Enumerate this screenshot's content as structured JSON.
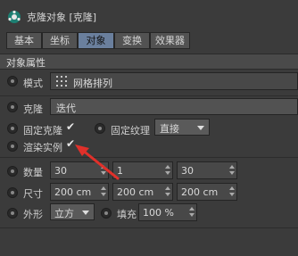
{
  "window": {
    "title": "克隆对象 [克隆]"
  },
  "tabs": [
    {
      "label": "基本",
      "active": false
    },
    {
      "label": "坐标",
      "active": false
    },
    {
      "label": "对象",
      "active": true
    },
    {
      "label": "变换",
      "active": false
    },
    {
      "label": "效果器",
      "active": false
    }
  ],
  "section": {
    "title": "对象属性"
  },
  "mode": {
    "label": "模式",
    "value": "网格排列"
  },
  "clone": {
    "label": "克隆",
    "value": "迭代"
  },
  "fix_clone": {
    "label": "固定克隆",
    "checked": "✔"
  },
  "fix_texture": {
    "label": "固定纹理",
    "value": "直接"
  },
  "render_instances": {
    "label": "渲染实例",
    "checked": "✔"
  },
  "count": {
    "label": "数量",
    "values": [
      "30",
      "1",
      "30"
    ]
  },
  "size": {
    "label": "尺寸",
    "values": [
      "200 cm",
      "200 cm",
      "200 cm"
    ]
  },
  "shape": {
    "label": "外形",
    "value": "立方"
  },
  "fill": {
    "label": "填充",
    "value": "100 %"
  },
  "colors": {
    "accent": "#6a7f9d",
    "annotation": "#e0302a"
  }
}
